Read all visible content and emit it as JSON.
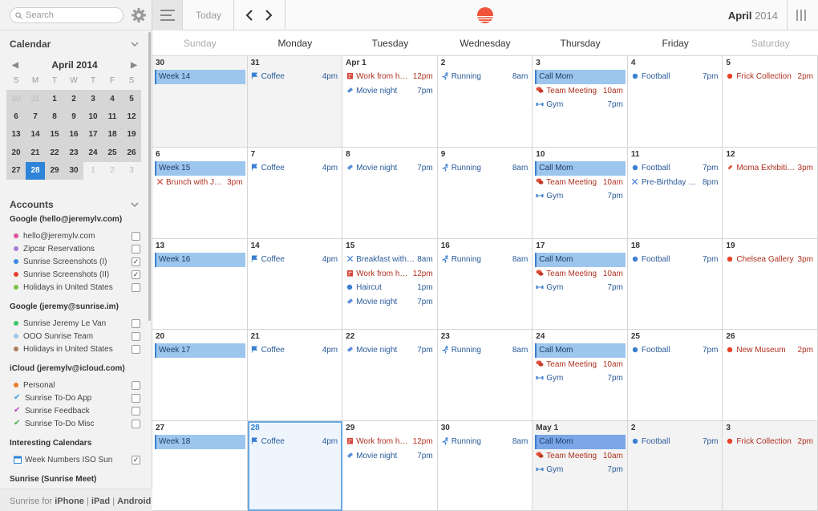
{
  "search": {
    "placeholder": "Search"
  },
  "sidebar": {
    "calendar_title": "Calendar",
    "accounts_title": "Accounts",
    "footer": {
      "prefix": "Sunrise for ",
      "iphone": "iPhone",
      "sep1": " | ",
      "ipad": "iPad",
      "sep2": " | ",
      "android": "Android"
    }
  },
  "mini_cal": {
    "title": "April 2014",
    "dow": [
      "S",
      "M",
      "T",
      "W",
      "T",
      "F",
      "S"
    ],
    "days": [
      {
        "d": "30",
        "c": "out"
      },
      {
        "d": "31",
        "c": "out"
      },
      {
        "d": "1",
        "c": ""
      },
      {
        "d": "2",
        "c": ""
      },
      {
        "d": "3",
        "c": ""
      },
      {
        "d": "4",
        "c": ""
      },
      {
        "d": "5",
        "c": ""
      },
      {
        "d": "6",
        "c": ""
      },
      {
        "d": "7",
        "c": ""
      },
      {
        "d": "8",
        "c": ""
      },
      {
        "d": "9",
        "c": ""
      },
      {
        "d": "10",
        "c": ""
      },
      {
        "d": "11",
        "c": ""
      },
      {
        "d": "12",
        "c": ""
      },
      {
        "d": "13",
        "c": ""
      },
      {
        "d": "14",
        "c": ""
      },
      {
        "d": "15",
        "c": ""
      },
      {
        "d": "16",
        "c": ""
      },
      {
        "d": "17",
        "c": ""
      },
      {
        "d": "18",
        "c": ""
      },
      {
        "d": "19",
        "c": ""
      },
      {
        "d": "20",
        "c": ""
      },
      {
        "d": "21",
        "c": ""
      },
      {
        "d": "22",
        "c": ""
      },
      {
        "d": "23",
        "c": ""
      },
      {
        "d": "24",
        "c": ""
      },
      {
        "d": "25",
        "c": ""
      },
      {
        "d": "26",
        "c": ""
      },
      {
        "d": "27",
        "c": ""
      },
      {
        "d": "28",
        "c": "today"
      },
      {
        "d": "29",
        "c": ""
      },
      {
        "d": "30",
        "c": ""
      },
      {
        "d": "1",
        "c": "after"
      },
      {
        "d": "2",
        "c": "after"
      },
      {
        "d": "3",
        "c": "after"
      }
    ]
  },
  "accounts": [
    {
      "title": "Google (hello@jeremylv.com)",
      "items": [
        {
          "label": "hello@jeremylv.com",
          "color": "#e0529c",
          "mark": "dot",
          "checked": false
        },
        {
          "label": "Zipcar Reservations",
          "color": "#a67bd8",
          "mark": "dot",
          "checked": false
        },
        {
          "label": "Sunrise Screenshots (I)",
          "color": "#3b86e0",
          "mark": "dot",
          "checked": true
        },
        {
          "label": "Sunrise Screenshots (II)",
          "color": "#e8402a",
          "mark": "dot",
          "checked": true
        },
        {
          "label": "Holidays in United States",
          "color": "#7dc040",
          "mark": "dot",
          "checked": false
        }
      ]
    },
    {
      "title": "Google (jeremy@sunrise.im)",
      "items": [
        {
          "label": "Sunrise Jeremy Le Van",
          "color": "#3fc46f",
          "mark": "dot",
          "checked": false
        },
        {
          "label": "OOO Sunrise Team",
          "color": "#a0c4ea",
          "mark": "dot",
          "checked": false
        },
        {
          "label": "Holidays in United States",
          "color": "#b07a5a",
          "mark": "dot",
          "checked": false
        }
      ]
    },
    {
      "title": "iCloud (jeremylv@icloud.com)",
      "items": [
        {
          "label": "Personal",
          "color": "#f07a2a",
          "mark": "dot",
          "checked": false
        },
        {
          "label": "Sunrise To-Do App",
          "color": "#3b9ee0",
          "mark": "check",
          "checked": false
        },
        {
          "label": "Sunrise Feedback",
          "color": "#c040c0",
          "mark": "check",
          "checked": false
        },
        {
          "label": "Sunrise To-Do Misc",
          "color": "#3fb04a",
          "mark": "check",
          "checked": false
        }
      ]
    },
    {
      "title": "Interesting Calendars",
      "items": [
        {
          "label": "Week Numbers ISO Sun",
          "color": "#2e84d8",
          "mark": "cal",
          "checked": true
        }
      ]
    },
    {
      "title": "Sunrise (Sunrise Meet)",
      "items": []
    }
  ],
  "toolbar": {
    "today_label": "Today",
    "month": "April",
    "year": "2014"
  },
  "weekdays": [
    {
      "label": "Sunday",
      "weekend": true
    },
    {
      "label": "Monday",
      "weekend": false
    },
    {
      "label": "Tuesday",
      "weekend": false
    },
    {
      "label": "Wednesday",
      "weekend": false
    },
    {
      "label": "Thursday",
      "weekend": false
    },
    {
      "label": "Friday",
      "weekend": false
    },
    {
      "label": "Saturday",
      "weekend": true
    }
  ],
  "weeks": [
    [
      {
        "day": "30",
        "style": "grey",
        "events": [
          {
            "type": "week",
            "title": "Week 14"
          }
        ]
      },
      {
        "day": "31",
        "style": "grey",
        "events": [
          {
            "icon": "flag",
            "title": "Coffee",
            "time": "4pm"
          }
        ]
      },
      {
        "day": "Apr 1",
        "style": "",
        "events": [
          {
            "icon": "building",
            "color": "red",
            "title": "Work from ho…",
            "time": "12pm"
          },
          {
            "icon": "ticket",
            "title": "Movie night",
            "time": "7pm"
          }
        ]
      },
      {
        "day": "2",
        "style": "",
        "events": [
          {
            "icon": "run",
            "title": "Running",
            "time": "8am"
          }
        ]
      },
      {
        "day": "3",
        "style": "",
        "events": [
          {
            "type": "callmom",
            "title": "Call Mom"
          },
          {
            "icon": "chat",
            "color": "red",
            "title": "Team Meeting",
            "time": "10am"
          },
          {
            "icon": "gym",
            "title": "Gym",
            "time": "7pm"
          }
        ]
      },
      {
        "day": "4",
        "style": "",
        "events": [
          {
            "icon": "dot",
            "title": "Football",
            "time": "7pm"
          }
        ]
      },
      {
        "day": "5",
        "style": "",
        "events": [
          {
            "icon": "reddot",
            "color": "red",
            "title": "Frick Collection",
            "time": "2pm"
          }
        ]
      }
    ],
    [
      {
        "day": "6",
        "style": "",
        "events": [
          {
            "type": "week",
            "title": "Week 15"
          },
          {
            "icon": "fork",
            "color": "red",
            "title": "Brunch with Je…",
            "time": "3pm"
          }
        ]
      },
      {
        "day": "7",
        "style": "",
        "events": [
          {
            "icon": "flag",
            "title": "Coffee",
            "time": "4pm"
          }
        ]
      },
      {
        "day": "8",
        "style": "",
        "events": [
          {
            "icon": "ticket",
            "title": "Movie night",
            "time": "7pm"
          }
        ]
      },
      {
        "day": "9",
        "style": "",
        "events": [
          {
            "icon": "run",
            "title": "Running",
            "time": "8am"
          }
        ]
      },
      {
        "day": "10",
        "style": "",
        "events": [
          {
            "type": "callmom",
            "title": "Call Mom"
          },
          {
            "icon": "chat",
            "color": "red",
            "title": "Team Meeting",
            "time": "10am"
          },
          {
            "icon": "gym",
            "title": "Gym",
            "time": "7pm"
          }
        ]
      },
      {
        "day": "11",
        "style": "",
        "events": [
          {
            "icon": "dot",
            "title": "Football",
            "time": "7pm"
          },
          {
            "icon": "fork",
            "title": "Pre-Birthday D…",
            "time": "8pm"
          }
        ]
      },
      {
        "day": "12",
        "style": "",
        "events": [
          {
            "icon": "pin",
            "color": "red",
            "title": "Moma Exhibition",
            "time": "3pm"
          }
        ]
      }
    ],
    [
      {
        "day": "13",
        "style": "",
        "events": [
          {
            "type": "week",
            "title": "Week 16"
          }
        ]
      },
      {
        "day": "14",
        "style": "",
        "events": [
          {
            "icon": "flag",
            "title": "Coffee",
            "time": "4pm"
          }
        ]
      },
      {
        "day": "15",
        "style": "",
        "events": [
          {
            "icon": "fork",
            "title": "Breakfast with …",
            "time": "8am"
          },
          {
            "icon": "building",
            "color": "red",
            "title": "Work from ho…",
            "time": "12pm"
          },
          {
            "icon": "dot",
            "title": "Haircut",
            "time": "1pm"
          },
          {
            "icon": "ticket",
            "title": "Movie night",
            "time": "7pm"
          }
        ]
      },
      {
        "day": "16",
        "style": "",
        "events": [
          {
            "icon": "run",
            "title": "Running",
            "time": "8am"
          }
        ]
      },
      {
        "day": "17",
        "style": "",
        "events": [
          {
            "type": "callmom",
            "title": "Call Mom"
          },
          {
            "icon": "chat",
            "color": "red",
            "title": "Team Meeting",
            "time": "10am"
          },
          {
            "icon": "gym",
            "title": "Gym",
            "time": "7pm"
          }
        ]
      },
      {
        "day": "18",
        "style": "",
        "events": [
          {
            "icon": "dot",
            "title": "Football",
            "time": "7pm"
          }
        ]
      },
      {
        "day": "19",
        "style": "",
        "events": [
          {
            "icon": "reddot",
            "color": "red",
            "title": "Chelsea Gallery",
            "time": "3pm"
          }
        ]
      }
    ],
    [
      {
        "day": "20",
        "style": "",
        "events": [
          {
            "type": "week",
            "title": "Week 17"
          }
        ]
      },
      {
        "day": "21",
        "style": "",
        "events": [
          {
            "icon": "flag",
            "title": "Coffee",
            "time": "4pm"
          }
        ]
      },
      {
        "day": "22",
        "style": "",
        "events": [
          {
            "icon": "ticket",
            "title": "Movie night",
            "time": "7pm"
          }
        ]
      },
      {
        "day": "23",
        "style": "",
        "events": [
          {
            "icon": "run",
            "title": "Running",
            "time": "8am"
          }
        ]
      },
      {
        "day": "24",
        "style": "",
        "events": [
          {
            "type": "callmom",
            "title": "Call Mom"
          },
          {
            "icon": "chat",
            "color": "red",
            "title": "Team Meeting",
            "time": "10am"
          },
          {
            "icon": "gym",
            "title": "Gym",
            "time": "7pm"
          }
        ]
      },
      {
        "day": "25",
        "style": "",
        "events": [
          {
            "icon": "dot",
            "title": "Football",
            "time": "7pm"
          }
        ]
      },
      {
        "day": "26",
        "style": "",
        "events": [
          {
            "icon": "reddot",
            "color": "red",
            "title": "New Museum",
            "time": "2pm"
          }
        ]
      }
    ],
    [
      {
        "day": "27",
        "style": "",
        "events": [
          {
            "type": "week",
            "title": "Week 18"
          }
        ]
      },
      {
        "day": "28",
        "style": "sel",
        "dayColor": "blue",
        "events": [
          {
            "icon": "flag",
            "title": "Coffee",
            "time": "4pm"
          }
        ]
      },
      {
        "day": "29",
        "style": "",
        "events": [
          {
            "icon": "building",
            "color": "red",
            "title": "Work from ho…",
            "time": "12pm"
          },
          {
            "icon": "ticket",
            "title": "Movie night",
            "time": "7pm"
          }
        ]
      },
      {
        "day": "30",
        "style": "",
        "events": [
          {
            "icon": "run",
            "title": "Running",
            "time": "8am"
          }
        ]
      },
      {
        "day": "May 1",
        "style": "grey",
        "events": [
          {
            "type": "callmom",
            "title": "Call Mom",
            "dark": true
          },
          {
            "icon": "chat",
            "color": "red",
            "title": "Team Meeting",
            "time": "10am"
          },
          {
            "icon": "gym",
            "title": "Gym",
            "time": "7pm"
          }
        ]
      },
      {
        "day": "2",
        "style": "grey",
        "events": [
          {
            "icon": "dot",
            "title": "Football",
            "time": "7pm"
          }
        ]
      },
      {
        "day": "3",
        "style": "grey",
        "events": [
          {
            "icon": "reddot",
            "color": "red",
            "title": "Frick Collection",
            "time": "2pm"
          }
        ]
      }
    ]
  ]
}
